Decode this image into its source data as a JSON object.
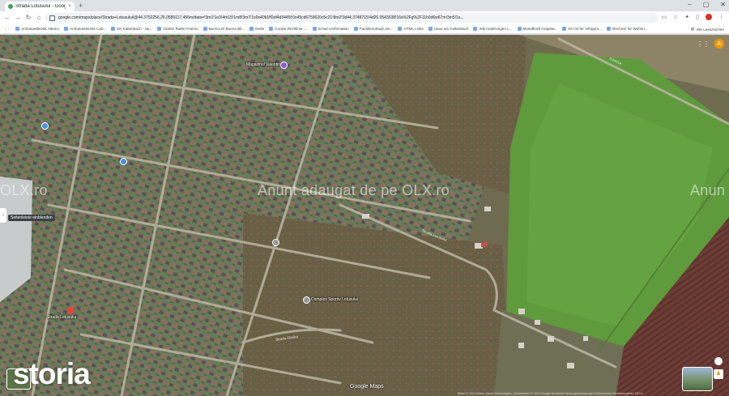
{
  "browser": {
    "tab_title": "Strada Lotusului - Google Maps",
    "tab_close": "×",
    "new_tab": "+",
    "window_controls": [
      "–",
      "▢",
      "✕"
    ],
    "url": "google.com/maps/place/Strada+Lotusului/@44.3752256,26.0589117,456m/data=!3m1!1e3!4m15!1m8!3m7!1s0x40b1ff2ef4d3445f:0x45cd6759620c5c21!8m2!3d44.3748715!4d26.0543638!16s%2Fg%2F11h0d6w67m!3m5!1s..."
  },
  "bookmarks": [
    "Ambulantbezirk Altenrc",
    "Ambulantbezirk Cab...",
    "bei Kaltenbach - Sp...",
    "Grafen Ratlnr-Fraimo",
    "Bunica Di Buena Bil...",
    "Dede",
    "Cookie Richtlinie -...",
    "Email confirmation",
    "Familienurlaub am...",
    "HTML Links",
    "Haus am Kaltenbach",
    "IKB Anderungen L...",
    "Mosafkraft Graphia...",
    "Kit mit für refrigera...",
    "Rechner für Wohnn...",
    "Alle Lesezeichen"
  ],
  "map": {
    "place_label_top": "Magazinul Valentin",
    "place_label_mid": "Complex Sportiv Lotusului",
    "street_label": "Strada Lotusului",
    "road_labels": [
      "Strada Lotusului",
      "Strada Florilor",
      "DJ401A"
    ],
    "watermark_left": "OLX.ro",
    "watermark_center": "Anunt adaugat de pe OLX.ro",
    "watermark_right": "Anun",
    "sidebar_tooltip": "Seitenleiste einblenden",
    "profile_initial": "A",
    "google_logo": "Google Maps",
    "attribution": "Bilder © 2024 Airbus, Maxar Technologies | Kartendaten © 2024 Google  Rumänien  Nutzungsbedingungen  Datenschutz  Feedback geben  100 m"
  },
  "brand": {
    "storia": "storia"
  },
  "colors": {
    "accent": "#d93025",
    "brand_storia": "#ffffff"
  }
}
